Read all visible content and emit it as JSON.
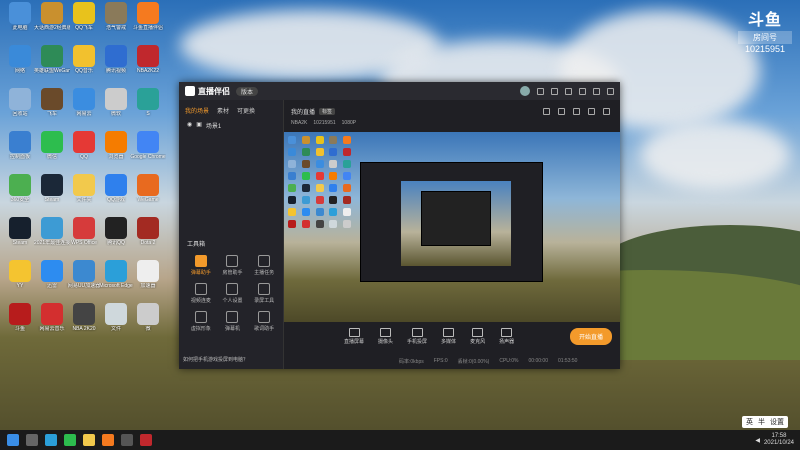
{
  "desktop": {
    "icons": [
      {
        "label": "此电脑",
        "color": "#4a90d9"
      },
      {
        "label": "大话西游2经典版",
        "color": "#c9902e"
      },
      {
        "label": "QQ飞车",
        "color": "#e8c21c"
      },
      {
        "label": "浩气警戒",
        "color": "#8a7a5a"
      },
      {
        "label": "斗鱼直播伴侣",
        "color": "#f57a1f"
      },
      {
        "label": "网络",
        "color": "#3a8ad9"
      },
      {
        "label": "英雄联盟WeGame",
        "color": "#2e8b57"
      },
      {
        "label": "QQ音乐",
        "color": "#f2c12e"
      },
      {
        "label": "腾讯视频",
        "color": "#2f6dd0"
      },
      {
        "label": "NBA2K22",
        "color": "#c0282d"
      },
      {
        "label": "回收站",
        "color": "#8fb3d9"
      },
      {
        "label": "飞车",
        "color": "#6a4a2a"
      },
      {
        "label": "网易云",
        "color": "#3b8de0"
      },
      {
        "label": "微软",
        "color": "#cccccc"
      },
      {
        "label": "S",
        "color": "#2aa198"
      },
      {
        "label": "控制面板",
        "color": "#3a7fd0"
      },
      {
        "label": "微信",
        "color": "#2dbd4e"
      },
      {
        "label": "QQ",
        "color": "#e53935"
      },
      {
        "label": "浏览器",
        "color": "#f57c00"
      },
      {
        "label": "Google Chrome",
        "color": "#4285f4"
      },
      {
        "label": "360安全",
        "color": "#4caf50"
      },
      {
        "label": "Steam",
        "color": "#1b2838"
      },
      {
        "label": "文件夹",
        "color": "#f2c94c"
      },
      {
        "label": "QQ游戏",
        "color": "#2f80ed"
      },
      {
        "label": "WeGame",
        "color": "#e86a1f"
      },
      {
        "label": "Steam",
        "color": "#16202d"
      },
      {
        "label": "2021年最佳连接",
        "color": "#3d9bd4"
      },
      {
        "label": "WPS Office",
        "color": "#d63b3b"
      },
      {
        "label": "腾讯QQ",
        "color": "#222222"
      },
      {
        "label": "Dota 2",
        "color": "#a32a22"
      },
      {
        "label": "YY",
        "color": "#f4c430"
      },
      {
        "label": "迅雷",
        "color": "#2d8cf0"
      },
      {
        "label": "网易UU加速器",
        "color": "#3c89d0"
      },
      {
        "label": "Microsoft Edge",
        "color": "#2b9fd9"
      },
      {
        "label": "加速器",
        "color": "#eeeeee"
      },
      {
        "label": "斗鱼",
        "color": "#b71c1c"
      },
      {
        "label": "网易云音乐",
        "color": "#d32f2f"
      },
      {
        "label": "NBA 2K20",
        "color": "#444444"
      },
      {
        "label": "文件",
        "color": "#cfd8dc"
      },
      {
        "label": "微",
        "color": "#cccccc"
      }
    ]
  },
  "watermark": {
    "logo": "斗鱼",
    "room_label": "房间号",
    "room_id": "10215951"
  },
  "app": {
    "name": "直播伴侣",
    "version_badge": "版本",
    "tabs": [
      "我的场景",
      "素材",
      "可更换"
    ],
    "scene_name": "场景1",
    "live_title": "我的直播",
    "live_tag": "标签",
    "category": "NBA2K",
    "room_id": "10215951",
    "resolution": "1080P",
    "tools_title": "工具箱",
    "tools": [
      {
        "label": "弹幕助手",
        "hot": true
      },
      {
        "label": "房管助手",
        "hot": false
      },
      {
        "label": "主播任务",
        "hot": false
      },
      {
        "label": "视频连麦",
        "hot": false
      },
      {
        "label": "个人设置",
        "hot": false
      },
      {
        "label": "录屏工具",
        "hot": false
      },
      {
        "label": "虚拟形象",
        "hot": false
      },
      {
        "label": "弹幕机",
        "hot": false
      },
      {
        "label": "歌词助手",
        "hot": false
      }
    ],
    "notice": "如何把手机游戏投屏到电脑？",
    "bottom_buttons": [
      "直播屏幕",
      "摄像头",
      "手机投屏",
      "多媒体",
      "麦克风",
      "扬声器"
    ],
    "start_button": "开始直播",
    "status": [
      "码率:0kbps",
      "FPS:0",
      "丢帧:0(0.00%)",
      "CPU:0%",
      "00:00:00",
      "01:53:50"
    ]
  },
  "taskbar": {
    "time": "17:58",
    "date": "2021/10/24",
    "ime": [
      "英",
      "半",
      "设置"
    ]
  }
}
